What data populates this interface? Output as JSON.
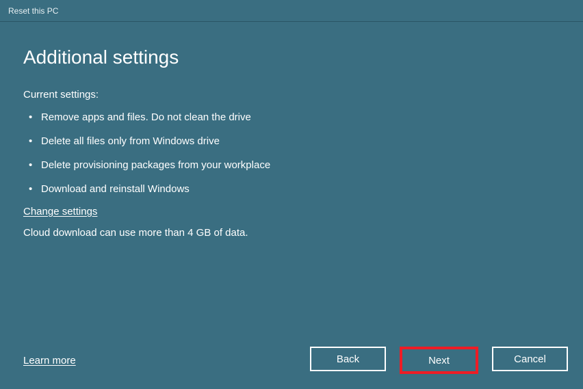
{
  "titlebar": {
    "title": "Reset this PC"
  },
  "main": {
    "heading": "Additional settings",
    "subheading": "Current settings:",
    "items": [
      "Remove apps and files. Do not clean the drive",
      "Delete all files only from Windows drive",
      "Delete provisioning packages from your workplace",
      "Download and reinstall Windows"
    ],
    "change_link": "Change settings",
    "info": "Cloud download can use more than 4 GB of data."
  },
  "footer": {
    "learn_more": "Learn more",
    "back": "Back",
    "next": "Next",
    "cancel": "Cancel"
  }
}
